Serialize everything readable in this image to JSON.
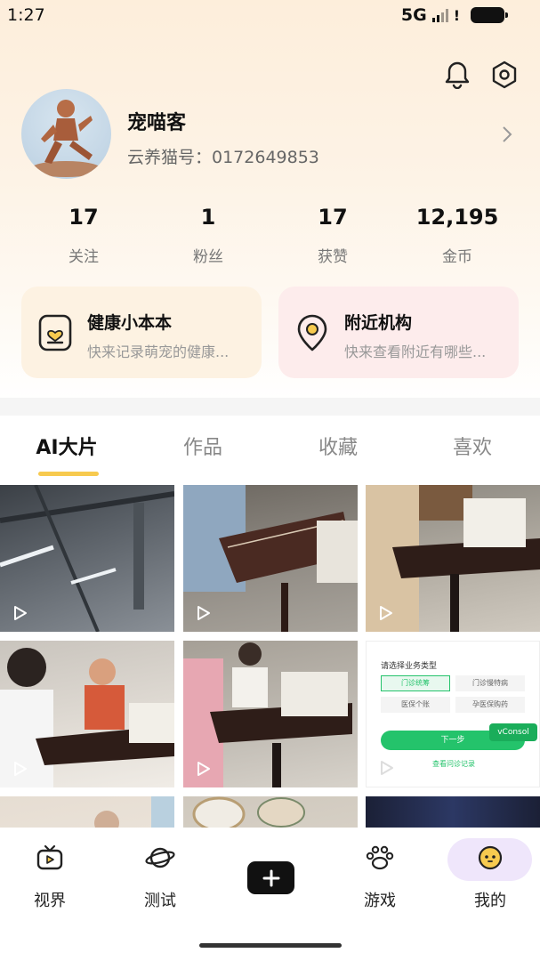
{
  "status_bar": {
    "time": "1:27",
    "network": "5G"
  },
  "profile": {
    "nickname": "宠喵客",
    "user_id": "云养猫号：0172649853"
  },
  "stats": [
    {
      "value": "17",
      "label": "关注"
    },
    {
      "value": "1",
      "label": "粉丝"
    },
    {
      "value": "17",
      "label": "获赞"
    },
    {
      "value": "12,195",
      "label": "金币"
    }
  ],
  "cards": {
    "health": {
      "title": "健康小本本",
      "subtitle": "快来记录萌宠的健康..."
    },
    "nearby": {
      "title": "附近机构",
      "subtitle": "快来查看附近有哪些..."
    }
  },
  "tabs": [
    {
      "label": "AI大片",
      "active": true
    },
    {
      "label": "作品",
      "active": false
    },
    {
      "label": "收藏",
      "active": false
    },
    {
      "label": "喜欢",
      "active": false
    }
  ],
  "form_thumb": {
    "heading": "请选择业务类型",
    "options": [
      "门诊统筹",
      "门诊慢特病",
      "医保个账",
      "孕医保购药"
    ],
    "next_button": "下一步",
    "history_link": "查看问诊记录",
    "vconsole": "vConsol"
  },
  "bottom_nav": [
    {
      "label": "视界",
      "icon": "tv-icon"
    },
    {
      "label": "测试",
      "icon": "planet-icon"
    },
    {
      "label": "",
      "icon": "plus-icon"
    },
    {
      "label": "游戏",
      "icon": "paw-icon"
    },
    {
      "label": "我的",
      "icon": "face-icon",
      "active": true
    }
  ],
  "colors": {
    "accent_yellow": "#f7ca4f",
    "active_pill": "#efe6fb",
    "health_card": "#fdf2e2",
    "nearby_card": "#fdecec",
    "form_green": "#24c36b"
  }
}
